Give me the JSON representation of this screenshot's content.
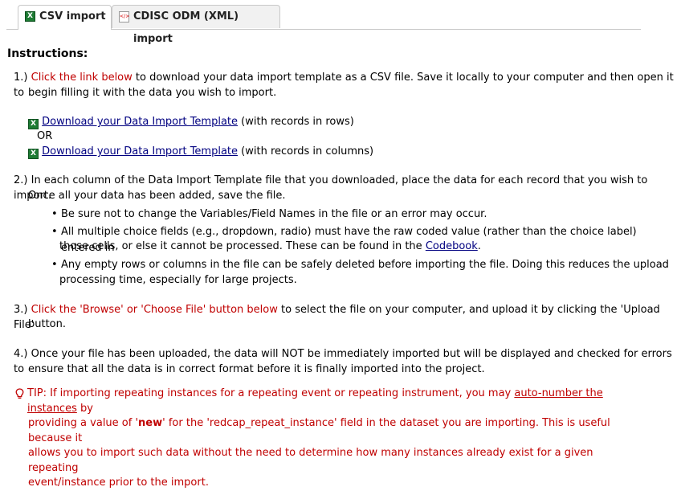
{
  "tabs": [
    {
      "label": "CSV import",
      "icon": "excel-icon"
    },
    {
      "label": "CDISC ODM (XML) import",
      "icon": "xml-file-icon"
    }
  ],
  "heading": "Instructions:",
  "step1": {
    "num": "1.)",
    "red": "Click the link below",
    "text_line1": " to download your data import template as a CSV file. Save it locally to your computer and then open it to",
    "text_line2": "begin filling it with the data you wish to import.",
    "link1": "Download your Data Import Template",
    "link1_suffix": " (with records in rows)",
    "or": "OR",
    "link2": "Download your Data Import Template",
    "link2_suffix": " (with records in columns)"
  },
  "step2": {
    "num": "2.)",
    "line1": "In each column of the Data Import Template file that you downloaded, place the data for each record that you wish to import.",
    "line2": "Once all your data has been added, save the file.",
    "bullets": [
      "Be sure not to change the Variables/Field Names in the file or an error may occur.",
      "All multiple choice fields (e.g., dropdown, radio) must have the raw coded value (rather than the choice label) entered in",
      "those cells, or else it cannot be processed. These can be found in the ",
      "Codebook",
      ".",
      "Any empty rows or columns in the file can be safely deleted before importing the file. Doing this reduces the upload",
      "processing time, especially for large projects."
    ]
  },
  "step3": {
    "num": "3.)",
    "red": "Click the 'Browse' or 'Choose File' button below",
    "line1": " to select the file on your computer, and upload it by clicking the 'Upload File'",
    "line2": "button."
  },
  "step4": {
    "num": "4.)",
    "line1": "Once your file has been uploaded, the data will NOT be immediately imported but will be displayed and checked for errors to",
    "line2": "ensure that all the data is in correct format before it is finally imported into the project."
  },
  "tip": {
    "a": "TIP: If importing repeating instances for a repeating event or repeating instrument, you may ",
    "link": "auto-number the instances",
    "b": " by",
    "c": "providing a value of '",
    "bold": "new",
    "d": "' for the 'redcap_repeat_instance' field in the dataset you are importing. This is useful because it",
    "e": "allows you to import such data without the need to determine how many instances already exist for a given repeating",
    "f": "event/instance prior to the import."
  }
}
